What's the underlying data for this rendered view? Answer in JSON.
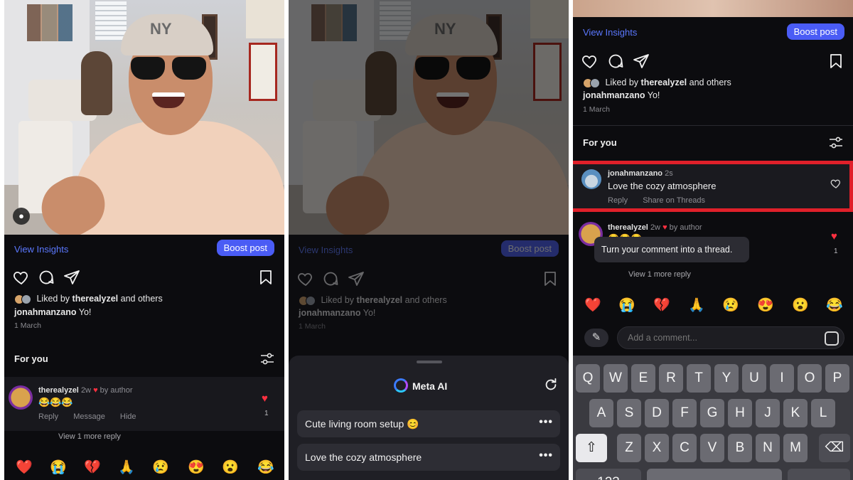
{
  "post": {
    "view_insights": "View Insights",
    "boost_post": "Boost post",
    "liked_prefix": "Liked by",
    "liked_user": "therealyzel",
    "liked_suffix": "and others",
    "caption_user": "jonahmanzano",
    "caption_text": "Yo!",
    "date": "1 March",
    "for_you": "For you",
    "cap_logo": "NY"
  },
  "panel1_comment": {
    "user": "therealyzel",
    "time": "2w",
    "by_author": "by author",
    "text": "😂😂😂",
    "actions": [
      "Reply",
      "Message",
      "Hide"
    ],
    "like_count": "1",
    "more_replies": "View 1 more reply"
  },
  "reactions": [
    "❤️",
    "😭",
    "💔",
    "🙏",
    "😢",
    "😍",
    "😮",
    "😂"
  ],
  "meta_ai": {
    "title": "Meta AI",
    "suggestions": [
      "Cute living room setup 😊",
      "Love the cozy atmosphere"
    ],
    "more": "•••"
  },
  "panel3": {
    "new_comment": {
      "user": "jonahmanzano",
      "time": "2s",
      "text": "Love the cozy atmosphere",
      "actions": [
        "Reply",
        "Share on Threads"
      ]
    },
    "prev_comment": {
      "user": "therealyzel",
      "time": "2w",
      "by_author": "by author",
      "text": "😂😂😂",
      "like_count": "1",
      "more_replies": "View 1 more reply"
    },
    "tooltip": "Turn your comment into a thread.",
    "comment_placeholder": "Add a comment...",
    "keyboard_rows": [
      [
        "Q",
        "W",
        "E",
        "R",
        "T",
        "Y",
        "U",
        "I",
        "O",
        "P"
      ],
      [
        "A",
        "S",
        "D",
        "F",
        "G",
        "H",
        "J",
        "K",
        "L"
      ],
      [
        "Z",
        "X",
        "C",
        "V",
        "B",
        "N",
        "M"
      ]
    ],
    "key_123": "123"
  },
  "colors": {
    "accent_blue": "#4a5cf5",
    "link_blue": "#5b78ff",
    "like_red": "#ff3040",
    "highlight_red": "#e0202a"
  }
}
